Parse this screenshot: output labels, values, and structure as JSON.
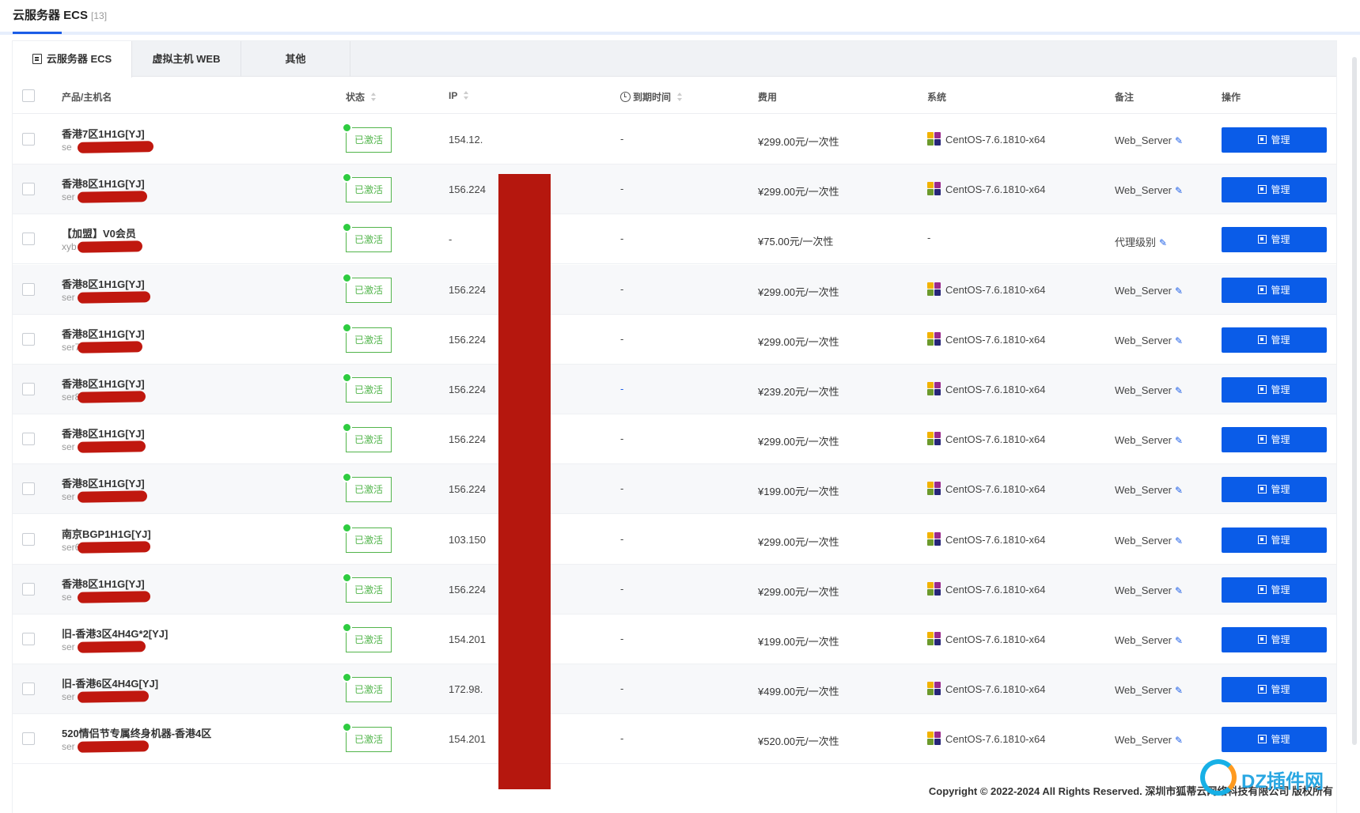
{
  "page": {
    "title": "云服务器 ECS",
    "count": "[13]"
  },
  "tabs": [
    {
      "label": "云服务器 ECS",
      "icon": "server-icon",
      "active": true
    },
    {
      "label": "虚拟主机 WEB",
      "active": false
    },
    {
      "label": "其他",
      "active": false
    }
  ],
  "table": {
    "headers": {
      "product": "产品/主机名",
      "status": "状态",
      "ip": "IP",
      "expire": "到期时间",
      "fee": "费用",
      "os": "系统",
      "remark": "备注",
      "action": "操作"
    },
    "rows": [
      {
        "product": "香港7区1H1G[YJ]",
        "host": "se",
        "status": "已激活",
        "ip": "154.12.",
        "expire": "-",
        "fee": "¥299.00元/一次性",
        "os": "CentOS-7.6.1810-x64",
        "remark": "Web_Server",
        "action": "管理"
      },
      {
        "product": "香港8区1H1G[YJ]",
        "host": "ser",
        "status": "已激活",
        "ip": "156.224",
        "expire": "-",
        "fee": "¥299.00元/一次性",
        "os": "CentOS-7.6.1810-x64",
        "remark": "Web_Server",
        "action": "管理"
      },
      {
        "product": "【加盟】V0会员",
        "host": "xyb",
        "status": "已激活",
        "ip": "-",
        "expire": "-",
        "fee": "¥75.00元/一次性",
        "os": "-",
        "remark": "代理级别",
        "action": "管理"
      },
      {
        "product": "香港8区1H1G[YJ]",
        "host": "ser",
        "status": "已激活",
        "ip": "156.224",
        "expire": "-",
        "fee": "¥299.00元/一次性",
        "os": "CentOS-7.6.1810-x64",
        "remark": "Web_Server",
        "action": "管理"
      },
      {
        "product": "香港8区1H1G[YJ]",
        "host": "ser7",
        "status": "已激活",
        "ip": "156.224",
        "expire": "-",
        "fee": "¥299.00元/一次性",
        "os": "CentOS-7.6.1810-x64",
        "remark": "Web_Server",
        "action": "管理"
      },
      {
        "product": "香港8区1H1G[YJ]",
        "host": "ser8",
        "status": "已激活",
        "ip": "156.224",
        "expire": "-",
        "fee": "¥239.20元/一次性",
        "os": "CentOS-7.6.1810-x64",
        "remark": "Web_Server",
        "action": "管理"
      },
      {
        "product": "香港8区1H1G[YJ]",
        "host": "ser",
        "status": "已激活",
        "ip": "156.224",
        "expire": "-",
        "fee": "¥299.00元/一次性",
        "os": "CentOS-7.6.1810-x64",
        "remark": "Web_Server",
        "action": "管理"
      },
      {
        "product": "香港8区1H1G[YJ]",
        "host": "ser",
        "status": "已激活",
        "ip": "156.224",
        "expire": "-",
        "fee": "¥199.00元/一次性",
        "os": "CentOS-7.6.1810-x64",
        "remark": "Web_Server",
        "action": "管理"
      },
      {
        "product": "南京BGP1H1G[YJ]",
        "host": "ser6",
        "status": "已激活",
        "ip": "103.150",
        "expire": "-",
        "fee": "¥299.00元/一次性",
        "os": "CentOS-7.6.1810-x64",
        "remark": "Web_Server",
        "action": "管理"
      },
      {
        "product": "香港8区1H1G[YJ]",
        "host": "se",
        "status": "已激活",
        "ip": "156.224",
        "expire": "-",
        "fee": "¥299.00元/一次性",
        "os": "CentOS-7.6.1810-x64",
        "remark": "Web_Server",
        "action": "管理"
      },
      {
        "product": "旧-香港3区4H4G*2[YJ]",
        "host": "ser",
        "status": "已激活",
        "ip": "154.201",
        "expire": "-",
        "fee": "¥199.00元/一次性",
        "os": "CentOS-7.6.1810-x64",
        "remark": "Web_Server",
        "action": "管理"
      },
      {
        "product": "旧-香港6区4H4G[YJ]",
        "host": "ser",
        "status": "已激活",
        "ip": "172.98.",
        "expire": "-",
        "fee": "¥499.00元/一次性",
        "os": "CentOS-7.6.1810-x64",
        "remark": "Web_Server",
        "action": "管理"
      },
      {
        "product": "520情侣节专属终身机器-香港4区",
        "host": "ser",
        "status": "已激活",
        "ip": "154.201",
        "expire": "-",
        "fee": "¥520.00元/一次性",
        "os": "CentOS-7.6.1810-x64",
        "remark": "Web_Server",
        "action": "管理"
      }
    ]
  },
  "footer": {
    "copyright": "Copyright © 2022-2024 All Rights Reserved. 深圳市狐蒂云网络科技有限公司 版权所有"
  },
  "watermark": {
    "text": "DZ插件网"
  },
  "colors": {
    "accent": "#0a5ce8",
    "status_green": "#52b54b",
    "redaction": "#b5170e"
  }
}
